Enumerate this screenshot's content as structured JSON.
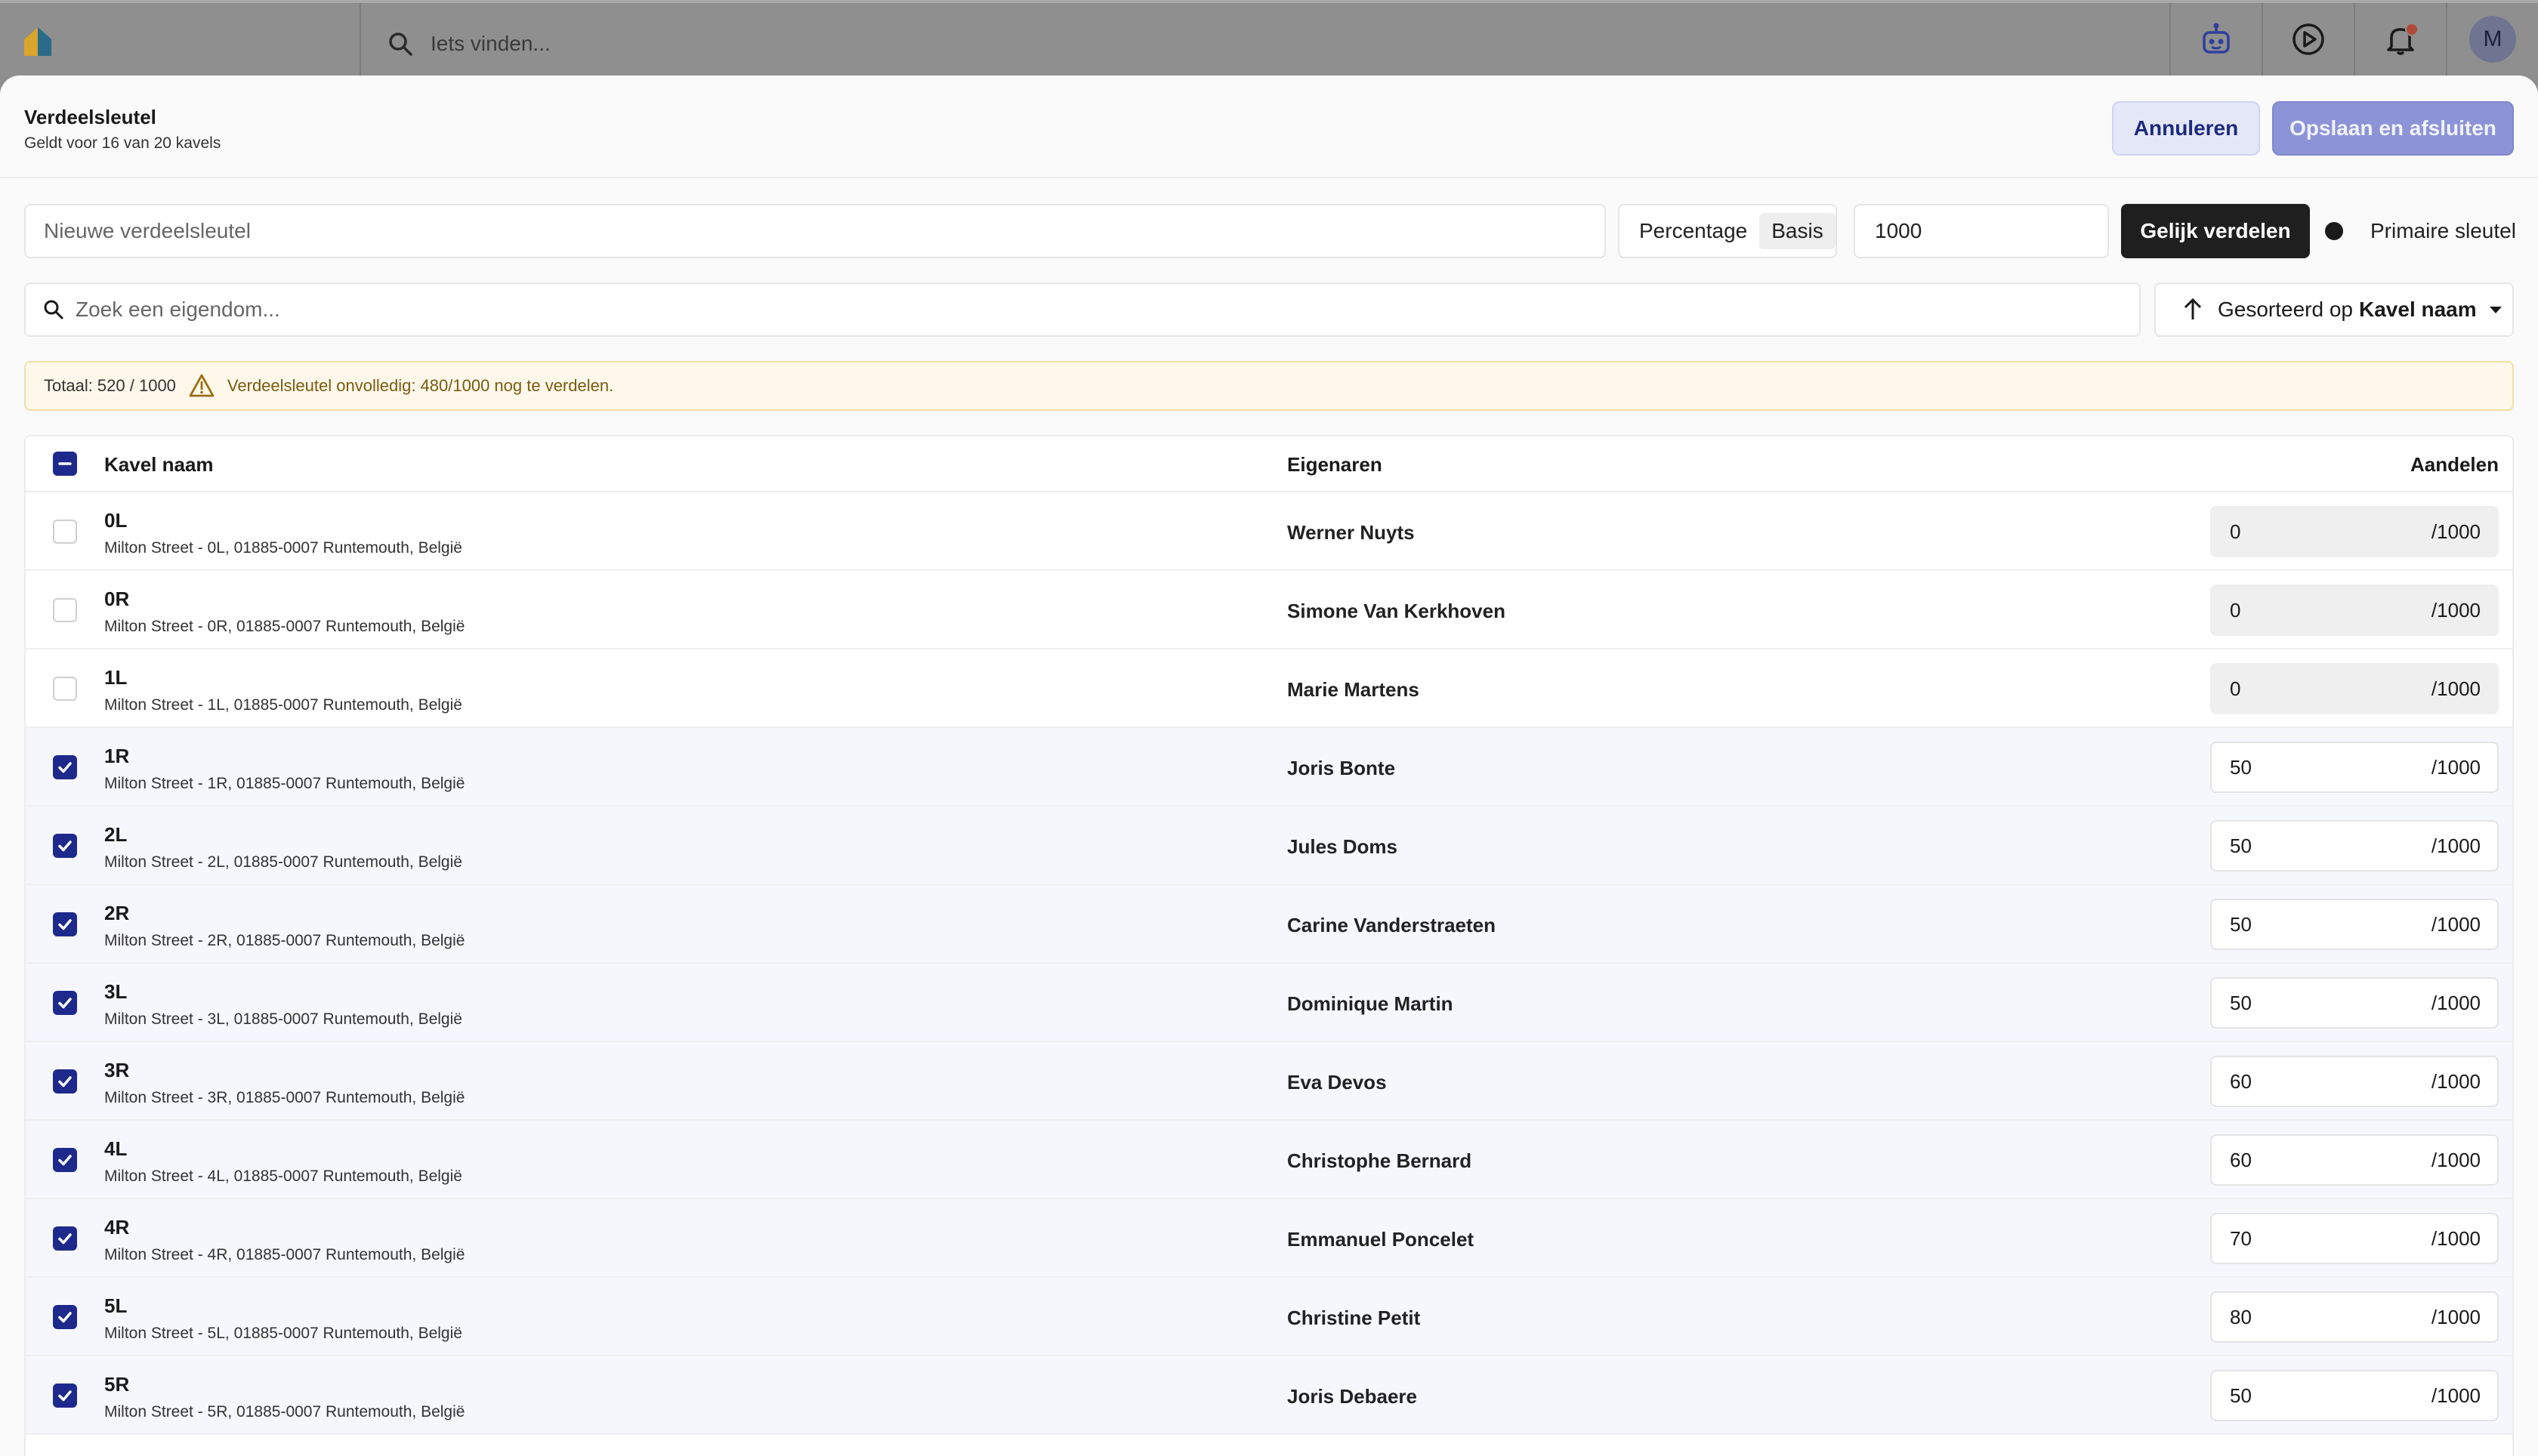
{
  "topbar": {
    "search_placeholder": "Iets vinden...",
    "avatar_initial": "M",
    "icons": [
      "logo-icon",
      "search-icon",
      "bot-icon",
      "play-icon",
      "bell-icon"
    ]
  },
  "modal": {
    "title": "Verdeelsleutel",
    "subtitle": "Geldt voor 16 van 20 kavels",
    "cancel_label": "Annuleren",
    "save_label": "Opslaan en afsluiten"
  },
  "controls": {
    "key_name_placeholder": "Nieuwe verdeelsleutel",
    "mode_options": [
      "Percentage",
      "Basis"
    ],
    "mode_selected": "Basis",
    "base_value": "1000",
    "equal_label": "Gelijk verdelen",
    "primary_label": "Primaire sleutel",
    "search_placeholder": "Zoek een eigendom...",
    "sort_prefix": "Gesorteerd op",
    "sort_field": "Kavel naam"
  },
  "warning": {
    "total": "Totaal: 520 / 1000",
    "message": "Verdeelsleutel onvolledig: 480/1000 nog te verdelen."
  },
  "table": {
    "headers": {
      "name": "Kavel naam",
      "owners": "Eigenaren",
      "shares": "Aandelen"
    },
    "share_suffix": "/1000",
    "rows": [
      {
        "code": "0L",
        "address": "Milton Street - 0L, 01885-0007 Runtemouth, België",
        "owner": "Werner Nuyts",
        "share": "0",
        "checked": false
      },
      {
        "code": "0R",
        "address": "Milton Street - 0R, 01885-0007 Runtemouth, België",
        "owner": "Simone Van Kerkhoven",
        "share": "0",
        "checked": false
      },
      {
        "code": "1L",
        "address": "Milton Street - 1L, 01885-0007 Runtemouth, België",
        "owner": "Marie Martens",
        "share": "0",
        "checked": false
      },
      {
        "code": "1R",
        "address": "Milton Street - 1R, 01885-0007 Runtemouth, België",
        "owner": "Joris Bonte",
        "share": "50",
        "checked": true
      },
      {
        "code": "2L",
        "address": "Milton Street - 2L, 01885-0007 Runtemouth, België",
        "owner": "Jules Doms",
        "share": "50",
        "checked": true
      },
      {
        "code": "2R",
        "address": "Milton Street - 2R, 01885-0007 Runtemouth, België",
        "owner": "Carine Vanderstraeten",
        "share": "50",
        "checked": true
      },
      {
        "code": "3L",
        "address": "Milton Street - 3L, 01885-0007 Runtemouth, België",
        "owner": "Dominique Martin",
        "share": "50",
        "checked": true
      },
      {
        "code": "3R",
        "address": "Milton Street - 3R, 01885-0007 Runtemouth, België",
        "owner": "Eva Devos",
        "share": "60",
        "checked": true
      },
      {
        "code": "4L",
        "address": "Milton Street - 4L, 01885-0007 Runtemouth, België",
        "owner": "Christophe Bernard",
        "share": "60",
        "checked": true
      },
      {
        "code": "4R",
        "address": "Milton Street - 4R, 01885-0007 Runtemouth, België",
        "owner": "Emmanuel Poncelet",
        "share": "70",
        "checked": true
      },
      {
        "code": "5L",
        "address": "Milton Street - 5L, 01885-0007 Runtemouth, België",
        "owner": "Christine Petit",
        "share": "80",
        "checked": true
      },
      {
        "code": "5R",
        "address": "Milton Street - 5R, 01885-0007 Runtemouth, België",
        "owner": "Joris Debaere",
        "share": "50",
        "checked": true
      }
    ]
  },
  "colors": {
    "accent": "#1d2a8c",
    "save_button": "#8c93d6",
    "cancel_button": "#e4e7f8",
    "warning_bg": "#fdf8ea",
    "warning_text": "#7a5a10"
  }
}
